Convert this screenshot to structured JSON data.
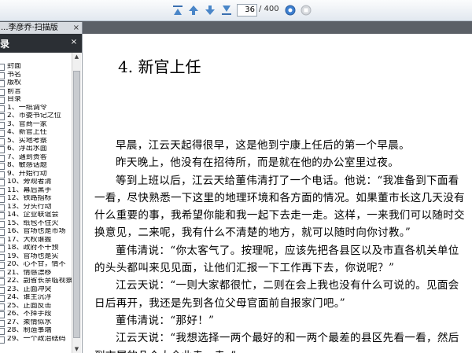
{
  "toolbar": {
    "current_page": "36",
    "total_pages": "/ 400",
    "buttons": [
      "first-page-icon",
      "prev-page-icon",
      "next-page-icon",
      "last-page-icon",
      "go-icon",
      "stop-icon"
    ]
  },
  "tab": {
    "label": "...李彦乔·扫描版",
    "close": "×"
  },
  "sidebar": {
    "title": "录",
    "close": "×",
    "items": [
      {
        "label": "封面"
      },
      {
        "label": "书名"
      },
      {
        "label": "版权"
      },
      {
        "label": "前言"
      },
      {
        "label": "目录"
      },
      {
        "label": "1、一纸调令"
      },
      {
        "label": "2、市委书记之位"
      },
      {
        "label": "3、官商一家"
      },
      {
        "label": "4、新官上任"
      },
      {
        "label": "5、实地考察"
      },
      {
        "label": "6、浮出水面"
      },
      {
        "label": "7、遇到贵客"
      },
      {
        "label": "8、敏感话题"
      },
      {
        "label": "9、开始行动"
      },
      {
        "label": "10、旁观者清"
      },
      {
        "label": "11、幕后黑手"
      },
      {
        "label": "12、铁路指标"
      },
      {
        "label": "13、分头行动"
      },
      {
        "label": "14、企业联谊会"
      },
      {
        "label": "15、纸包不住火"
      },
      {
        "label": "16、官场也是市场"
      },
      {
        "label": "17、大权谁握"
      },
      {
        "label": "18、政府不干预"
      },
      {
        "label": "19、官场也是实"
      },
      {
        "label": "20、心不甘，情不"
      },
      {
        "label": "21、情感漂移"
      },
      {
        "label": "22、副省长亲临视察"
      },
      {
        "label": "23、正面冲突"
      },
      {
        "label": "24、谁主沉浮"
      },
      {
        "label": "25、正面反击"
      },
      {
        "label": "26、不择手段"
      },
      {
        "label": "27、柔情似水"
      },
      {
        "label": "28、制造事端"
      },
      {
        "label": "29、一个政治砝码"
      }
    ]
  },
  "document": {
    "chapter_title": "4.  新官上任",
    "paragraphs": [
      "早晨，江云天起得很早，这是他到宁康上任后的第一个早晨。",
      "昨天晚上，他没有在招待所，而是就在他的办公室里过夜。",
      "等到上班以后，江云天给董伟清打了一个电话。他说：“我准备到下面看一看，尽快熟悉一下这里的地理环境和各方面的情况。如果董市长这几天没有什么重要的事，我希望你能和我一起下去走一走。这样，一来我们可以随时交换意见，二来呢，我有什么不清楚的地方，就可以随时向你讨教。”",
      "董伟清说：“你太客气了。按理呢，应该先把各县区以及市直各机关单位的头头都叫来见见面，让他们汇报一下工作再下去，你说呢？”",
      "江云天说：“一则大家都很忙，二则在会上我也没有什么可说的。见面会日后再开，我还是先到各位父母官面前自报家门吧。”",
      "董伟清说：“那好！”",
      "江云天说：“我想选择一两个最好的和一两个最差的县区先看一看，然后到市属的几个大企业走一走。”"
    ]
  }
}
